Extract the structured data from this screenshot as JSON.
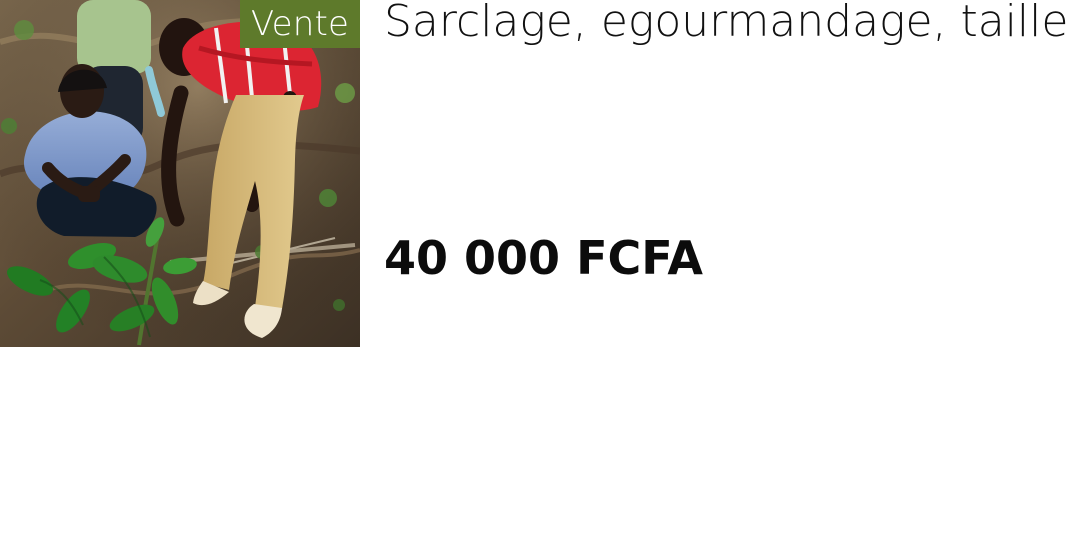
{
  "listing": {
    "badge": "Vente",
    "title": "Sarclage, egourmandage, taille",
    "price": "40 000 FCFA"
  },
  "colors": {
    "badge_background": "#5e7a2b",
    "text": "#111111",
    "background": "#ffffff"
  }
}
